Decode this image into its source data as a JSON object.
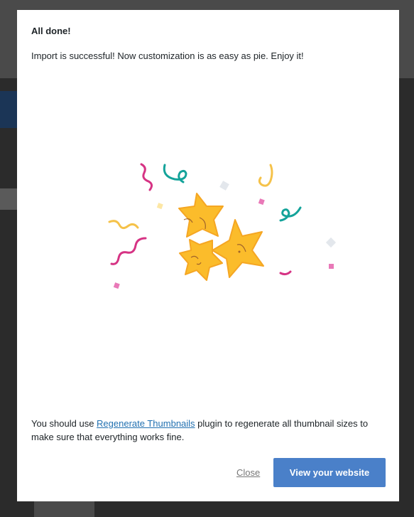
{
  "modal": {
    "title": "All done!",
    "message": "Import is successful! Now customization is as easy as pie. Enjoy it!",
    "note_before": "You should use ",
    "note_link": "Regenerate Thumbnails",
    "note_after": " plugin to regenerate all thumbnail sizes to make sure that everything works fine.",
    "close_label": "Close",
    "primary_label": "View your website"
  },
  "colors": {
    "primary_button": "#4a80c9",
    "link": "#2271b1",
    "star": "#fbbc2b",
    "confetti_pink": "#d63384",
    "confetti_teal": "#14a39a",
    "confetti_yellow": "#f5c24a"
  }
}
